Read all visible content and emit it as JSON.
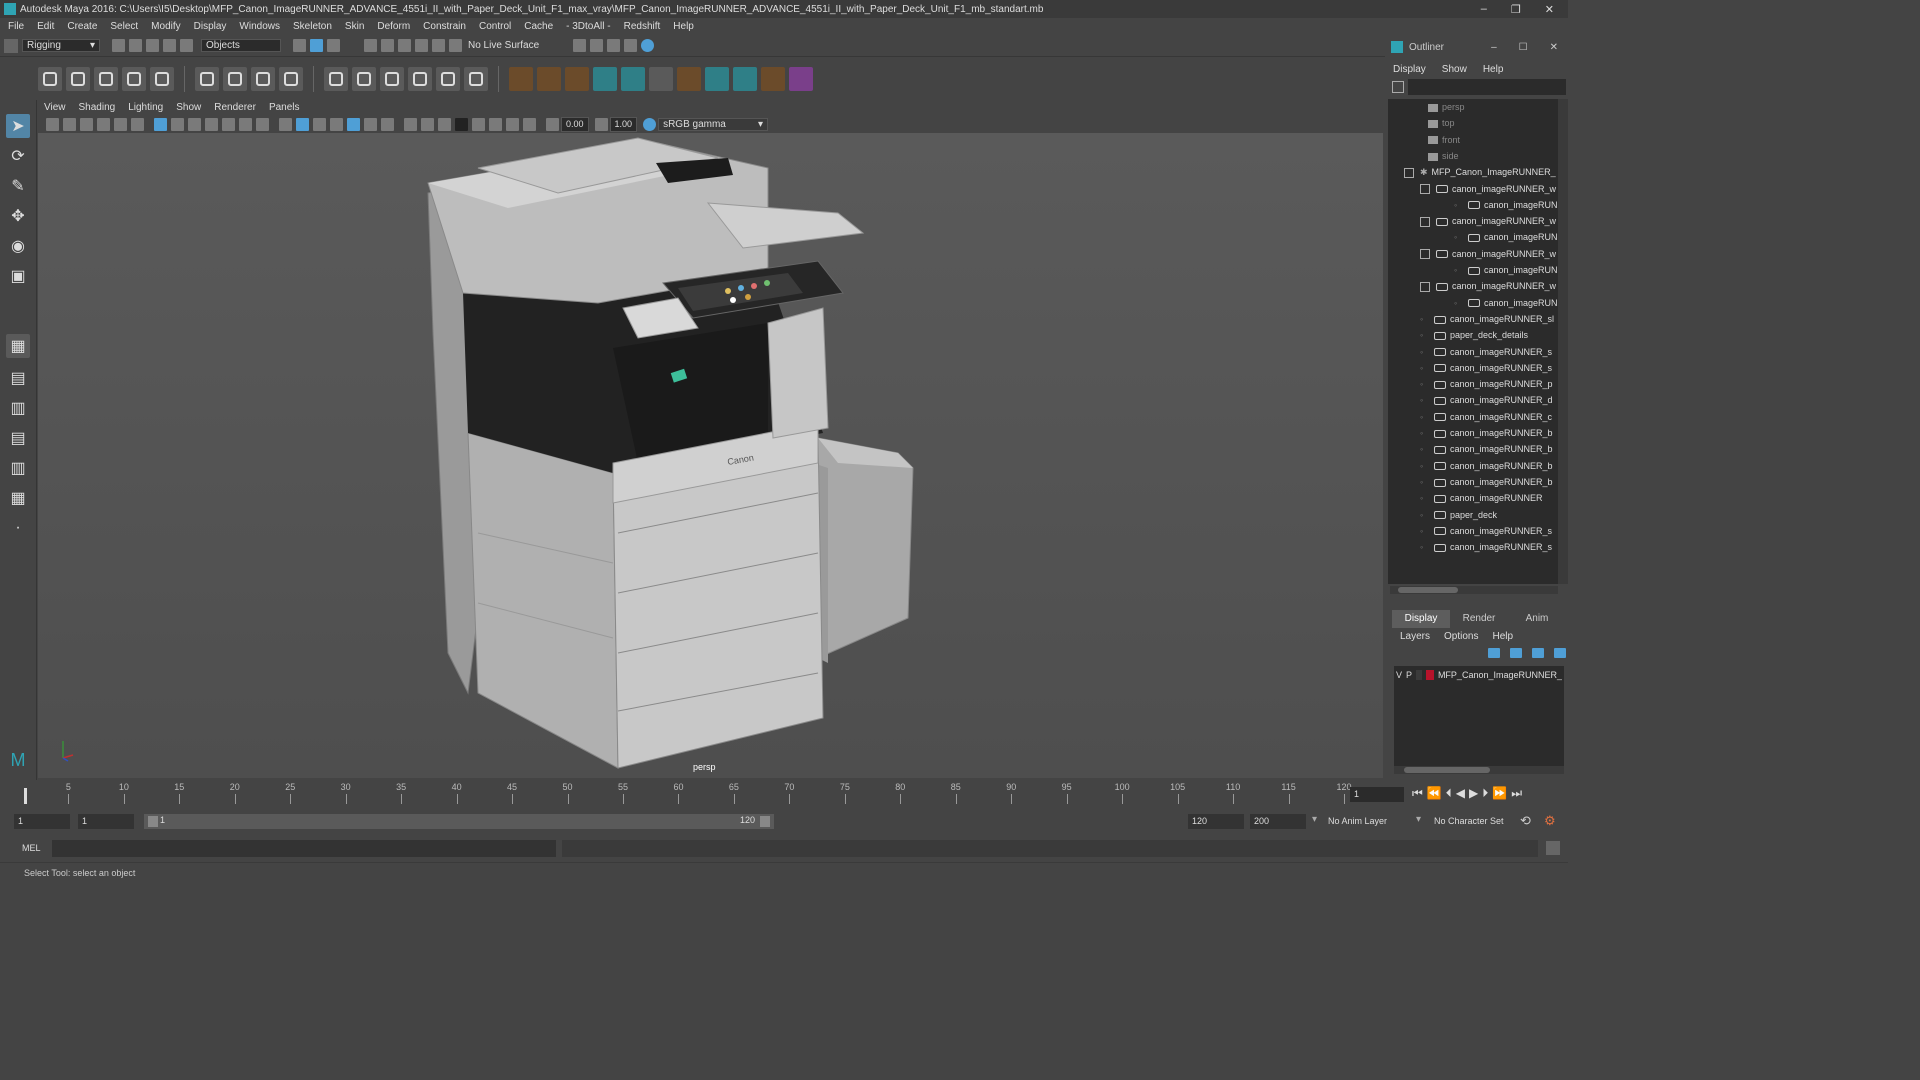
{
  "window": {
    "title": "Autodesk Maya 2016: C:\\Users\\I5\\Desktop\\MFP_Canon_ImageRUNNER_ADVANCE_4551i_II_with_Paper_Deck_Unit_F1_max_vray\\MFP_Canon_ImageRUNNER_ADVANCE_4551i_II_with_Paper_Deck_Unit_F1_mb_standart.mb"
  },
  "menu": [
    "File",
    "Edit",
    "Create",
    "Select",
    "Modify",
    "Display",
    "Windows",
    "Skeleton",
    "Skin",
    "Deform",
    "Constrain",
    "Control",
    "Cache",
    "- 3DtoAll -",
    "Redshift",
    "Help"
  ],
  "statusline": {
    "mode": "Rigging",
    "select_mode": "Objects",
    "live_surface": "No Live Surface"
  },
  "viewport": {
    "menu": [
      "View",
      "Shading",
      "Lighting",
      "Show",
      "Renderer",
      "Panels"
    ],
    "exposure": "0.00",
    "gamma": "1.00",
    "color_space": "sRGB gamma",
    "camera_label": "persp",
    "brand_label": "Canon"
  },
  "outliner": {
    "title": "Outliner",
    "menu": [
      "Display",
      "Show",
      "Help"
    ],
    "cameras": [
      "persp",
      "top",
      "front",
      "side"
    ],
    "root": "MFP_Canon_ImageRUNNER_",
    "items": [
      {
        "label": "canon_imageRUNNER_w",
        "depth": 1,
        "expand": true
      },
      {
        "label": "canon_imageRUNNE",
        "depth": 2,
        "expand": false
      },
      {
        "label": "canon_imageRUNNER_w",
        "depth": 1,
        "expand": true
      },
      {
        "label": "canon_imageRUNNE",
        "depth": 2,
        "expand": false
      },
      {
        "label": "canon_imageRUNNER_w",
        "depth": 1,
        "expand": true
      },
      {
        "label": "canon_imageRUNNE",
        "depth": 2,
        "expand": false
      },
      {
        "label": "canon_imageRUNNER_w",
        "depth": 1,
        "expand": true
      },
      {
        "label": "canon_imageRUNNE",
        "depth": 2,
        "expand": false
      },
      {
        "label": "canon_imageRUNNER_sl",
        "depth": 1,
        "expand": false
      },
      {
        "label": "paper_deck_details",
        "depth": 1,
        "expand": false
      },
      {
        "label": "canon_imageRUNNER_s",
        "depth": 1,
        "expand": false
      },
      {
        "label": "canon_imageRUNNER_s",
        "depth": 1,
        "expand": false
      },
      {
        "label": "canon_imageRUNNER_p",
        "depth": 1,
        "expand": false
      },
      {
        "label": "canon_imageRUNNER_d",
        "depth": 1,
        "expand": false
      },
      {
        "label": "canon_imageRUNNER_c",
        "depth": 1,
        "expand": false
      },
      {
        "label": "canon_imageRUNNER_b",
        "depth": 1,
        "expand": false
      },
      {
        "label": "canon_imageRUNNER_b",
        "depth": 1,
        "expand": false
      },
      {
        "label": "canon_imageRUNNER_b",
        "depth": 1,
        "expand": false
      },
      {
        "label": "canon_imageRUNNER_b",
        "depth": 1,
        "expand": false
      },
      {
        "label": "canon_imageRUNNER",
        "depth": 1,
        "expand": false
      },
      {
        "label": "paper_deck",
        "depth": 1,
        "expand": false
      },
      {
        "label": "canon_imageRUNNER_s",
        "depth": 1,
        "expand": false
      },
      {
        "label": "canon_imageRUNNER_s",
        "depth": 1,
        "expand": false
      }
    ]
  },
  "layers": {
    "tabs": [
      "Display",
      "Render",
      "Anim"
    ],
    "menu": [
      "Layers",
      "Options",
      "Help"
    ],
    "row": {
      "v": "V",
      "p": "P",
      "name": "MFP_Canon_ImageRUNNER_",
      "color": "#b8132b"
    }
  },
  "timeline": {
    "ticks": [
      1,
      5,
      10,
      15,
      20,
      25,
      30,
      35,
      40,
      45,
      50,
      55,
      60,
      65,
      70,
      75,
      80,
      85,
      90,
      95,
      100,
      105,
      110,
      115,
      120
    ],
    "current_frame": "1"
  },
  "range": {
    "start": "1",
    "playback_start": "1",
    "slider_start": "1",
    "slider_end": "120",
    "playback_end": "120",
    "end": "200",
    "anim_layer": "No Anim Layer",
    "char_set": "No Character Set"
  },
  "cmd": {
    "label": "MEL"
  },
  "help": {
    "text": "Select Tool: select an object"
  }
}
